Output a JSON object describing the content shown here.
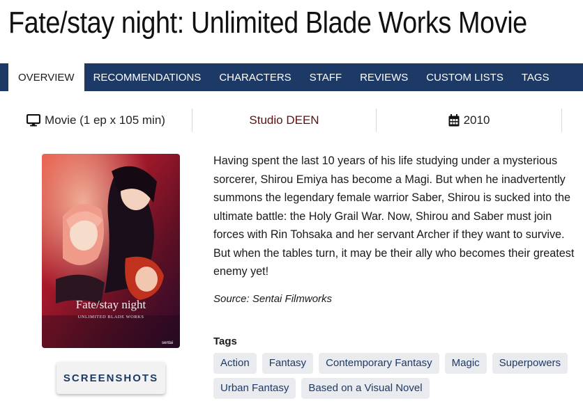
{
  "page_title": "Fate/stay night: Unlimited Blade Works Movie",
  "nav": {
    "tabs": [
      "OVERVIEW",
      "RECOMMENDATIONS",
      "CHARACTERS",
      "STAFF",
      "REVIEWS",
      "CUSTOM LISTS",
      "TAGS"
    ],
    "active": "OVERVIEW"
  },
  "info": {
    "format": "Movie (1 ep x 105 min)",
    "format_icon": "monitor-icon",
    "studio": "Studio DEEN",
    "year": "2010",
    "year_icon": "calendar-icon"
  },
  "poster": {
    "logo_text": "Fate/stay night",
    "logo_sub": "UNLIMITED BLADE WORKS",
    "corner_mark": "sentai"
  },
  "screenshots_button": "SCREENSHOTS",
  "synopsis": "Having spent the last 10 years of his life studying under a mysterious sorcerer, Shirou Emiya has become a Magi. But when he inadvertently summons the legendary female warrior Saber, Shirou is sucked into the ultimate battle: the Holy Grail War. Now, Shirou and Saber must join forces with Rin Tohsaka and her servant Archer if they want to survive. But when the tables turn, it may be their ally who becomes their greatest enemy yet!",
  "source": "Source: Sentai Filmworks",
  "tags_heading": "Tags",
  "tags": [
    "Action",
    "Fantasy",
    "Contemporary Fantasy",
    "Magic",
    "Superpowers",
    "Urban Fantasy",
    "Based on a Visual Novel"
  ],
  "colors": {
    "nav_bg": "#1d3a66",
    "studio": "#5b1212",
    "tag_bg": "#e9ebef",
    "tag_text": "#1d3a66"
  }
}
